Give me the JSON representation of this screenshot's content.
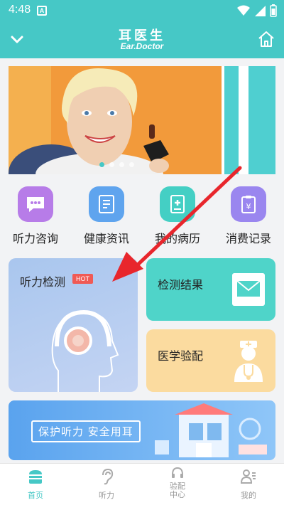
{
  "status": {
    "time": "4:48",
    "notif_letter": "A"
  },
  "header": {
    "title": "耳医生",
    "subtitle": "Ear.Doctor"
  },
  "menu": [
    {
      "label": "听力咨询",
      "color": "#b77ce8",
      "icon": "chat-icon"
    },
    {
      "label": "健康资讯",
      "color": "#5fa4ee",
      "icon": "document-icon"
    },
    {
      "label": "我的病历",
      "color": "#44cfc4",
      "icon": "medical-record-icon"
    },
    {
      "label": "消费记录",
      "color": "#9a86ef",
      "icon": "receipt-icon"
    }
  ],
  "cards": {
    "hearing_test": {
      "label": "听力检测",
      "badge": "HOT"
    },
    "test_results": {
      "label": "检测结果"
    },
    "fitting": {
      "label": "医学验配"
    }
  },
  "promo": {
    "text": "保护听力  安全用耳"
  },
  "nav": [
    {
      "label": "首页",
      "active": true,
      "icon": "home-basket-icon"
    },
    {
      "label": "听力",
      "active": false,
      "icon": "ear-icon"
    },
    {
      "label": "验配中心",
      "label_line1": "验配",
      "label_line2": "中心",
      "active": false,
      "icon": "headset-icon"
    },
    {
      "label": "我的",
      "active": false,
      "icon": "profile-icon"
    }
  ],
  "colors": {
    "primary": "#46c8c6",
    "annotation_arrow": "#e8262c"
  }
}
